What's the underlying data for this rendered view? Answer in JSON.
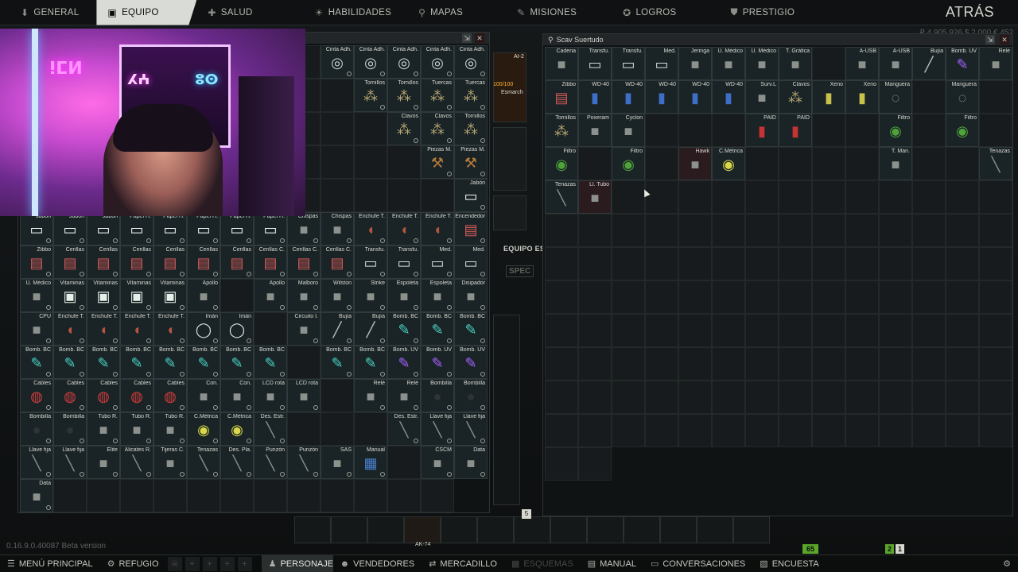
{
  "nav": {
    "tabs": [
      {
        "label": "GENERAL",
        "icon": "pin-icon"
      },
      {
        "label": "EQUIPO",
        "icon": "shirt-icon"
      },
      {
        "label": "SALUD",
        "icon": "health-icon"
      },
      {
        "label": "HABILIDADES",
        "icon": "skills-icon"
      },
      {
        "label": "MAPAS",
        "icon": "map-pin-icon"
      },
      {
        "label": "MISIONES",
        "icon": "tasks-icon"
      },
      {
        "label": "LOGROS",
        "icon": "achievements-icon"
      },
      {
        "label": "PRESTIGIO",
        "icon": "prestige-icon"
      }
    ],
    "active_tab": "EQUIPO",
    "back_label": "ATRÁS",
    "money_text": "₽ 4,905,926   $ 2,000   € 452"
  },
  "left_panel": {
    "items": [
      "",
      "",
      "",
      "",
      "",
      "",
      "",
      "",
      "",
      "Cinta Adh.",
      "Cinta Adh.",
      "Cinta Adh.",
      "Cinta Adh.",
      "Cinta Adh.",
      "Cinta Adh.",
      "",
      "",
      "",
      "",
      "",
      "",
      "",
      "",
      "",
      "Tornillos",
      "Tornillos",
      "Tuercas",
      "Tuercas",
      "Tuercas",
      "Tuercas",
      "",
      "",
      "",
      "",
      "",
      "",
      "",
      "",
      "",
      "Clavos",
      "Clavos",
      "Tornillos",
      "Tornillos",
      "Tornillos",
      "Tornillos",
      "",
      "",
      "",
      "",
      "",
      "",
      "",
      "",
      "",
      "Piezas M.",
      "Piezas M.",
      "Piezas M.",
      "Piezas M.",
      "Piezas M.",
      "Piezas M.",
      "",
      "",
      "",
      "",
      "",
      "",
      "",
      "",
      "",
      "Jabón",
      "Jabón",
      "Jabón",
      "Jabón",
      "Papel H.",
      "Papel H.",
      "Papel H.",
      "Papel H.",
      "Papel H.",
      "Chispas",
      "Chispas",
      "Enchufe T.",
      "Enchufe T.",
      "Enchufe T.",
      "Encendedor",
      "Zibbo",
      "Cerillas",
      "Cerillas",
      "Cerillas",
      "Cerillas",
      "Cerillas",
      "Cerillas",
      "Cerillas C.",
      "Cerillas C.",
      "Cerillas C.",
      "Transfu.",
      "Transfu.",
      "Med.",
      "Med.",
      "U. Médico",
      "Vitaminas",
      "Vitaminas",
      "Vitaminas",
      "Vitaminas",
      "Apollo",
      "",
      "Apollo",
      "Malboro",
      "Wilston",
      "Strike",
      "Espoleta",
      "Espoleta",
      "Disipador",
      "CPU",
      "Enchufe T.",
      "Enchufe T.",
      "Enchufe T.",
      "Enchufe T.",
      "Imán",
      "Imán",
      "",
      "Circuito I.",
      "Bujía",
      "Bujía",
      "Bomb. BC",
      "Bomb. BC",
      "Bomb. BC",
      "Bomb. BC",
      "Bomb. BC",
      "Bomb. BC",
      "Bomb. BC",
      "Bomb. BC",
      "Bomb. BC",
      "Bomb. BC",
      "Bomb. BC",
      "",
      "Bomb. BC",
      "Bomb. BC",
      "Bomb. UV",
      "Bomb. UV",
      "Bomb. UV",
      "Cables",
      "Cables",
      "Cables",
      "Cables",
      "Cables",
      "Con.",
      "Con.",
      "LCD rota",
      "LCD rota",
      "",
      "Relé",
      "Relé",
      "Bombilla",
      "Bombilla",
      "Bombilla",
      "Bombilla",
      "Tubo R.",
      "Tubo R.",
      "Tubo R.",
      "C.Métrica",
      "C.Métrica",
      "Des. Estr.",
      "",
      "",
      "",
      "Des. Estr.",
      "Llave fija",
      "Llave fija",
      "Llave fija",
      "Llave fija",
      "Elite",
      "Alicates R.",
      "Tijeras C.",
      "Tenazas",
      "Des. Pla.",
      "Punzón",
      "Punzón",
      "SAS",
      "Manual",
      "",
      "CSCM",
      "Data",
      "Data",
      "",
      "",
      "",
      "",
      "",
      "",
      "",
      "",
      "",
      "",
      "",
      ""
    ]
  },
  "mid": {
    "ai2": "AI-2",
    "ai2_value": "100/100",
    "esmarch": "Esmarch",
    "equip_label": "EQUIPO ES",
    "spec_label": "SPEC"
  },
  "scav": {
    "title": "Scav Suertudo",
    "row1": [
      "Cadena",
      "Transfu.",
      "Transfu.",
      "Med.",
      "Jeringa",
      "U. Médico",
      "U. Médico",
      "T. Gráfica",
      "",
      "A-USB",
      "A-USB",
      "Bujía",
      "Bomb. UV",
      "Relé"
    ],
    "row2": [
      "Zibbo",
      "WD-40",
      "WD-40",
      "WD-40",
      "WD-40",
      "WD-40",
      "Surv.L",
      "Clavos",
      "Xeno",
      "Xeno",
      "Manguera",
      "",
      "Manguera",
      ""
    ],
    "row3": [
      "Tornillos",
      "Poxeram",
      "Cyclon",
      "",
      "",
      "",
      "PAID",
      "PAID",
      "",
      "",
      "Filtro",
      "",
      "Filtro",
      ""
    ],
    "row4": [
      "Filtro",
      "",
      "Filtro",
      "",
      "Hawk",
      "C.Métrica",
      "",
      "",
      "",
      "",
      "T. Man.",
      "",
      "",
      "Tenazas"
    ],
    "row5": [
      "Tenazas",
      "Ll. Tubo"
    ]
  },
  "quickbar": {
    "slot_number": "5",
    "weapon_label": "AK-74"
  },
  "version": "0.16.9.0.40087 Beta version",
  "badges": {
    "level": "65",
    "count": "2",
    "count2": "1"
  },
  "bottom": {
    "items": [
      {
        "label": "MENÚ PRINCIPAL",
        "icon": "menu-icon"
      },
      {
        "label": "REFUGIO",
        "icon": "hideout-icon"
      },
      {
        "label": "PERSONAJE",
        "icon": "character-icon"
      },
      {
        "label": "VENDEDORES",
        "icon": "traders-icon"
      },
      {
        "label": "MERCADILLO",
        "icon": "flea-market-icon"
      },
      {
        "label": "ESQUEMAS",
        "icon": "schemes-icon"
      },
      {
        "label": "MANUAL",
        "icon": "manual-icon"
      },
      {
        "label": "CONVERSACIONES",
        "icon": "chat-icon"
      },
      {
        "label": "ENCUESTA",
        "icon": "survey-icon"
      }
    ]
  }
}
